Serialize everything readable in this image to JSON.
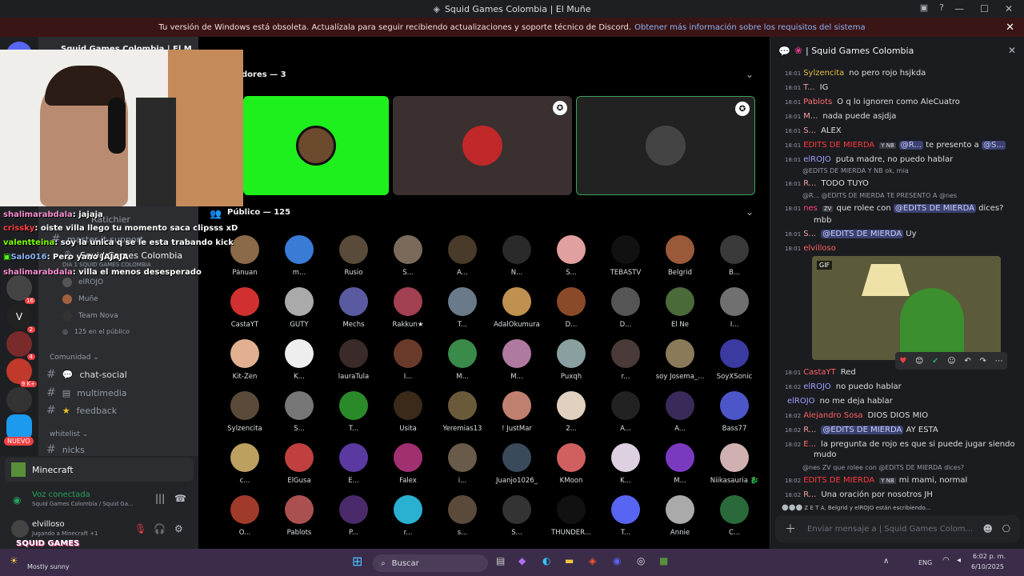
{
  "window": {
    "title": "Squid Games Colombia | El Muñe"
  },
  "banner": {
    "text": "Tu versión de Windows está obsoleta. Actualízala para seguir recibiendo actualizaciones y soporte técnico de Discord.",
    "link": "Obtener más información sobre los requisitos del sistema"
  },
  "server_badges": [
    "16",
    "2",
    "4",
    "9 K+",
    "NUEVO"
  ],
  "sidebar": {
    "server_name": "Squid Games Colombia | El M...",
    "items": [
      {
        "label": "Ratichier"
      },
      {
        "label": "master-it-support"
      },
      {
        "label": "Squid Games Colombia"
      },
      {
        "label": "DIA 1 SQUID GAMES COLOMBIA"
      },
      {
        "label": "elROJO"
      },
      {
        "label": "Muñe"
      },
      {
        "label": "Team Nova"
      },
      {
        "label": "125 en el público"
      }
    ],
    "category_comunidad": "Comunidad",
    "comunidad_channels": [
      "chat-social",
      "multimedia",
      "feedback"
    ],
    "category_whitelist": "whitelist",
    "whitelist_channels": [
      "nicks"
    ]
  },
  "activity": {
    "label": "Minecraft"
  },
  "voice": {
    "status": "Voz conectada",
    "channel": "Squid Games Colombia / Squid Ga..."
  },
  "user": {
    "name": "elvilloso",
    "status": "Jugando a Minecraft +1"
  },
  "stage": {
    "speakers_header": "dores — 3",
    "public_header": "Público — 125",
    "audience": [
      "Pánuan",
      "m...",
      "Rusio",
      "S...",
      "A...",
      "N...",
      "S...",
      "TEBASTV",
      "Belgrid",
      "B...",
      "CastaYT",
      "GUTY",
      "Mechs",
      "Rakkun★",
      "T...",
      "AdalOkumura",
      "D...",
      "D...",
      "El Ñe",
      "I...",
      "Kit-Zen",
      "K...",
      "lauraTula",
      "I...",
      "M...",
      "M...",
      "Puxqh",
      "r...",
      "soy Josema_...",
      "SoyXSonic",
      "Sylzencita",
      "S...",
      "T...",
      "Usita",
      "Yeremias13",
      "! JustMar",
      "2...",
      "A...",
      "A...",
      "Bass77",
      "c...",
      "ElGusa",
      "E...",
      "Falex",
      "i...",
      "Juanjo1026_",
      "KMoon",
      "K...",
      "M...",
      "Niikasauria 🐉",
      "O...",
      "Pablots",
      "P...",
      "r...",
      "s...",
      "S...",
      "THUNDER...",
      "T...",
      "Annie",
      "C..."
    ]
  },
  "chat": {
    "title": "| Squid Games Colombia",
    "input_placeholder": "Enviar mensaje a | Squid Games Colom...",
    "messages": [
      {
        "time": "18:01",
        "user": "Sylzencita",
        "text": "no pero rojo hsjkda"
      },
      {
        "time": "18:01",
        "user": "T...",
        "text": "IG"
      },
      {
        "time": "18:01",
        "user": "Pablots",
        "text": "O q lo ignoren como AleCuatro"
      },
      {
        "time": "18:01",
        "user": "M...",
        "text": "nada puede asjdja"
      },
      {
        "time": "18:01",
        "user": "S...",
        "text": "ALEX"
      },
      {
        "time": "18:01",
        "user": "EDITS DE MIERDA",
        "tag": "Y NB",
        "mention": "@R...",
        "text": "te presento a",
        "mention2": "@S..."
      },
      {
        "time": "18:01",
        "user": "elROJO",
        "text": "puta madre, no puedo hablar"
      },
      {
        "time": "18:01",
        "user": "R...",
        "text": "TODO TUYO"
      },
      {
        "time": "18:01",
        "user": "nes",
        "tag": "ZV",
        "text": "que rolee con",
        "mention": "@EDITS DE MIERDA",
        "text2": "dices?"
      },
      {
        "time": "18:01",
        "user": "S...",
        "mention": "@EDITS DE MIERDA",
        "text": "Uy"
      },
      {
        "time": "18:01",
        "user": "elvilloso",
        "text": ""
      },
      {
        "time": "18:01",
        "user": "CastaYT",
        "text": "Red"
      },
      {
        "time": "18:02",
        "user": "elROJO",
        "text": "no puedo hablar"
      },
      {
        "time": "",
        "user": "elROJO",
        "text": "no me deja hablar"
      },
      {
        "time": "18:02",
        "user": "Alejandro Sosa",
        "text": "DIOS DIOS MIO"
      },
      {
        "time": "18:02",
        "user": "R...",
        "mention": "@EDITS DE MIERDA",
        "text": "AY ESTA"
      },
      {
        "time": "18:02",
        "user": "E...",
        "text": "la pregunta de rojo es que si puede jugar siendo"
      },
      {
        "time": "18:02",
        "user": "EDITS DE MIERDA",
        "tag": "Y NB",
        "text": "mi mami, normal"
      },
      {
        "time": "18:02",
        "user": "R...",
        "text": "Una oración por nosotros JH"
      }
    ],
    "reply1": "@EDITS DE MIERDA  Y NB  ok, mia",
    "reply2": "@R...  @EDITS DE MIERDA  TE PRESENTO A  @nes",
    "reply3": "@nes  ZV  que rolee con @EDITS DE MIERDA dices?",
    "cont1": "mbb",
    "cont2": "mudo",
    "gif_label": "GIF",
    "typing": "Z E T A, Belgrid y elROJO están escribiendo..."
  },
  "stream_overlay": [
    {
      "user": "shalimarabdala",
      "text": ": jajaja"
    },
    {
      "user": "crissky",
      "text": ": oiste villa llego tu momento saca clipsss xD"
    },
    {
      "user": "valentteina",
      "text": ": soy la unica q se le esta trabando kick"
    },
    {
      "user": "Salo016",
      "text": ": Pero yano JAJAJA"
    },
    {
      "user": "shalimarabdala",
      "text": ": villa el menos desesperado"
    }
  ],
  "weather": {
    "logo": "SQUID GAMES",
    "text": "Mostly sunny"
  },
  "taskbar": {
    "search": "Buscar",
    "lang": "ENG",
    "time": "6:02 p. m.",
    "date": "6/10/2025"
  }
}
